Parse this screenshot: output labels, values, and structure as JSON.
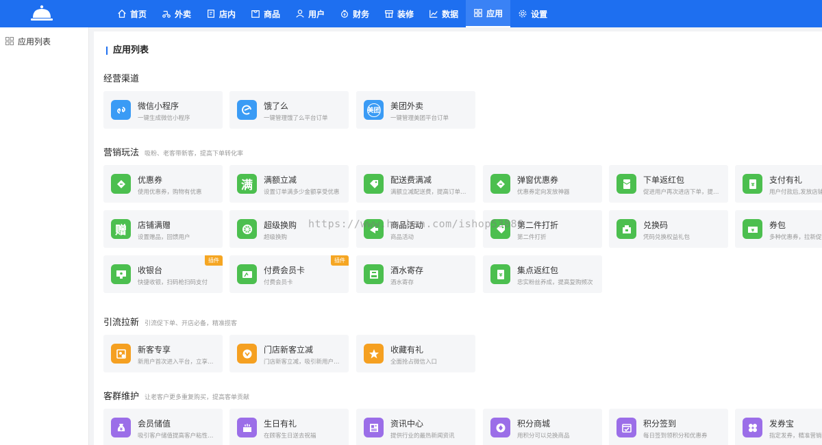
{
  "nav": {
    "items": [
      {
        "label": "首页",
        "icon": "home-icon"
      },
      {
        "label": "外卖",
        "icon": "takeout-icon"
      },
      {
        "label": "店内",
        "icon": "store-icon"
      },
      {
        "label": "商品",
        "icon": "goods-icon"
      },
      {
        "label": "用户",
        "icon": "user-icon"
      },
      {
        "label": "财务",
        "icon": "finance-icon"
      },
      {
        "label": "装修",
        "icon": "decorate-icon"
      },
      {
        "label": "数据",
        "icon": "chart-icon"
      },
      {
        "label": "应用",
        "icon": "apps-icon"
      },
      {
        "label": "设置",
        "icon": "gear-icon"
      }
    ],
    "active": "应用"
  },
  "sidebar": {
    "items": [
      {
        "label": "应用列表",
        "icon": "apps-icon"
      }
    ]
  },
  "page": {
    "title": "应用列表"
  },
  "sections": [
    {
      "title": "经营渠道",
      "subtitle": "",
      "cards": [
        {
          "name": "微信小程序",
          "desc": "一键生成微信小程序",
          "color": "#3a9bf5",
          "icon": "miniprogram-icon"
        },
        {
          "name": "饿了么",
          "desc": "一键管理饿了么平台订单",
          "color": "#3a9bf5",
          "icon": "eleme-icon"
        },
        {
          "name": "美团外卖",
          "desc": "一键管理美团平台订单",
          "color": "#3a9bf5",
          "icon": "meituan-icon",
          "glyph": "美团"
        }
      ]
    },
    {
      "title": "营销玩法",
      "subtitle": "吸粉、老客带新客，提高下单转化率",
      "cards": [
        {
          "name": "优惠券",
          "desc": "使用优惠券，购物有优惠",
          "color": "#4cbf4f",
          "icon": "coupon-icon"
        },
        {
          "name": "满额立减",
          "desc": "设置订单满多少金额享受优惠",
          "color": "#4cbf4f",
          "icon": "full-reduction-icon",
          "glyph": "满"
        },
        {
          "name": "配送费满减",
          "desc": "满额立减配送费，提高订单流量",
          "color": "#4cbf4f",
          "icon": "delivery-tag-icon"
        },
        {
          "name": "弹窗优惠券",
          "desc": "优惠券定向发放神器",
          "color": "#4cbf4f",
          "icon": "popup-coupon-icon"
        },
        {
          "name": "下单返红包",
          "desc": "促进用户再次进店下单，提升复购",
          "color": "#4cbf4f",
          "icon": "red-packet-icon"
        },
        {
          "name": "支付有礼",
          "desc": "用户付款后,发放店铺优惠",
          "color": "#4cbf4f",
          "icon": "pay-gift-icon"
        },
        {
          "name": "店铺满赠",
          "desc": "设置赠品，回馈用户",
          "color": "#4cbf4f",
          "icon": "gift-icon",
          "glyph": "赠"
        },
        {
          "name": "超级换购",
          "desc": "超级换购",
          "color": "#4cbf4f",
          "icon": "exchange-icon"
        },
        {
          "name": "商品活动",
          "desc": "商品活动",
          "color": "#4cbf4f",
          "icon": "promo-icon"
        },
        {
          "name": "第二件打折",
          "desc": "第二件打折",
          "color": "#4cbf4f",
          "icon": "discount-icon"
        },
        {
          "name": "兑换码",
          "desc": "凭码兑换权益礼包",
          "color": "#4cbf4f",
          "icon": "redeem-code-icon"
        },
        {
          "name": "券包",
          "desc": "多种优惠券，拉新促活",
          "color": "#4cbf4f",
          "icon": "coupon-pack-icon"
        },
        {
          "name": "收银台",
          "desc": "快捷收银，扫码枪扫码支付",
          "color": "#4cbf4f",
          "icon": "cashier-icon",
          "badge": "插件"
        },
        {
          "name": "付费会员卡",
          "desc": "付费会员卡",
          "color": "#4cbf4f",
          "icon": "member-card-icon",
          "badge": "插件"
        },
        {
          "name": "酒水寄存",
          "desc": "酒水寄存",
          "color": "#4cbf4f",
          "icon": "storage-icon"
        },
        {
          "name": "集点返红包",
          "desc": "忠实粉丝养成，提高复购频次",
          "color": "#4cbf4f",
          "icon": "points-packet-icon"
        }
      ]
    },
    {
      "title": "引流拉新",
      "subtitle": "引流促下单、开店必备，精准揽客",
      "cards": [
        {
          "name": "新客专享",
          "desc": "新用户首次进入平台，立享好礼",
          "color": "#f5a021",
          "icon": "new-customer-icon"
        },
        {
          "name": "门店新客立减",
          "desc": "门店新客立减，吸引新用户下单",
          "color": "#f5a021",
          "icon": "new-reduce-icon"
        },
        {
          "name": "收藏有礼",
          "desc": "全面抢占微信入口",
          "color": "#f5a021",
          "icon": "star-icon"
        }
      ]
    },
    {
      "title": "客群维护",
      "subtitle": "让老客户更多重复购买，提高客单贡献",
      "cards": [
        {
          "name": "会员储值",
          "desc": "吸引客户储值提高客户粘性和复购",
          "color": "#9b6ee8",
          "icon": "money-bag-icon"
        },
        {
          "name": "生日有礼",
          "desc": "在顾客生日送去祝福",
          "color": "#9b6ee8",
          "icon": "cake-icon"
        },
        {
          "name": "资讯中心",
          "desc": "提供行业的最热新闻资讯",
          "color": "#9b6ee8",
          "icon": "news-icon"
        },
        {
          "name": "积分商城",
          "desc": "用积分可以兑换商品",
          "color": "#9b6ee8",
          "icon": "points-mall-icon"
        },
        {
          "name": "积分签到",
          "desc": "每日签到领积分和优惠券",
          "color": "#9b6ee8",
          "icon": "calendar-check-icon"
        },
        {
          "name": "发券宝",
          "desc": "指定发券，精准营销",
          "color": "#9b6ee8",
          "icon": "coupon-send-icon"
        }
      ]
    }
  ],
  "watermark": "https://www.huzhan.com/ishop53886"
}
